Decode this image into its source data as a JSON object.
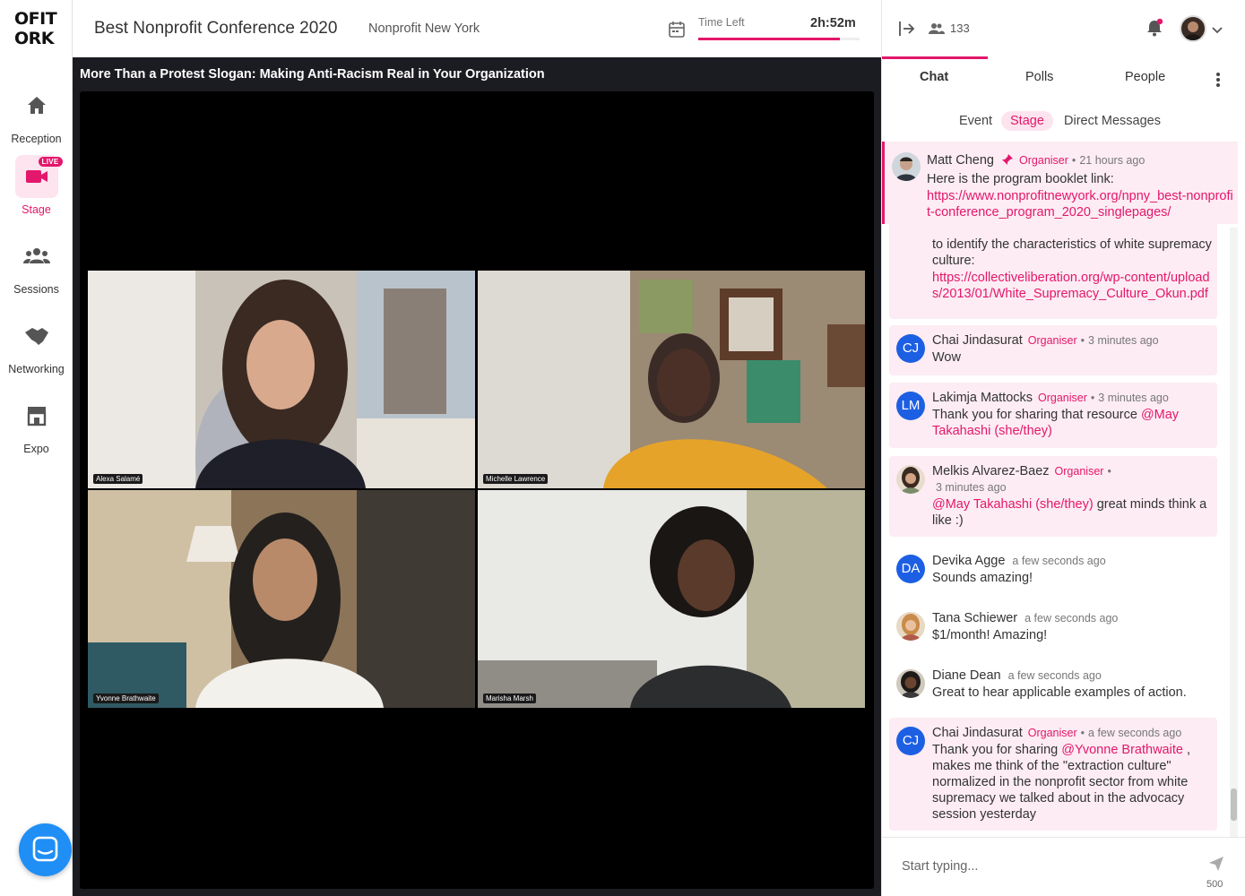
{
  "logo": {
    "line1": "OFIT",
    "line2": "ORK"
  },
  "nav": {
    "items": [
      {
        "label": "Reception",
        "icon": "home-icon"
      },
      {
        "label": "Stage",
        "icon": "video-camera-icon",
        "badge": "LIVE",
        "active": true
      },
      {
        "label": "Sessions",
        "icon": "group-icon"
      },
      {
        "label": "Networking",
        "icon": "handshake-icon"
      },
      {
        "label": "Expo",
        "icon": "store-icon"
      }
    ]
  },
  "header": {
    "event_title": "Best Nonprofit Conference 2020",
    "organizer": "Nonprofit New York",
    "time_left_label": "Time Left",
    "time_left_value": "2h:52m",
    "time_left_fraction": 0.88
  },
  "stage": {
    "session_title": "More Than a Protest Slogan: Making Anti-Racism Real in Your Organization",
    "participants": [
      {
        "name": "Alexa Salamé"
      },
      {
        "name": "Michelle Lawrence"
      },
      {
        "name": "Yvonne Brathwaite"
      },
      {
        "name": "Marisha Marsh"
      }
    ]
  },
  "panel": {
    "attendee_count": "133",
    "tabs": [
      "Chat",
      "Polls",
      "People"
    ],
    "active_tab": "Chat",
    "subtabs": [
      "Event",
      "Stage",
      "Direct Messages"
    ],
    "active_subtab": "Stage",
    "pinned": {
      "author": "Matt Cheng",
      "role": "Organiser",
      "time": "21 hours ago",
      "text": "Here is the program booklet link:",
      "link": "https://www.nonprofitnewyork.org/npny_best-nonprofit-conference_program_2020_singlepages/"
    },
    "messages": [
      {
        "text": "to identify the characteristics of white supremacy culture:",
        "link": "https://collectiveliberation.org/wp-content/uploads/2013/01/White_Supremacy_Culture_Okun.pdf"
      },
      {
        "initials": "CJ",
        "author": "Chai Jindasurat",
        "role": "Organiser",
        "time": "3 minutes ago",
        "text": "Wow"
      },
      {
        "initials": "LM",
        "author": "Lakimja Mattocks",
        "role": "Organiser",
        "time": "3 minutes ago",
        "text": "Thank you for sharing that resource",
        "mention": "@May Takahashi (she/they)"
      },
      {
        "author": "Melkis Alvarez-Baez",
        "role": "Organiser",
        "time": "3 minutes ago",
        "mention": "@May Takahashi (she/they)",
        "text": "great minds think a like :)"
      },
      {
        "initials": "DA",
        "author": "Devika Agge",
        "time": "a few seconds ago",
        "text": "Sounds amazing!"
      },
      {
        "author": "Tana Schiewer",
        "time": "a few seconds ago",
        "text": "$1/month! Amazing!"
      },
      {
        "author": "Diane Dean",
        "time": "a few seconds ago",
        "text": "Great to hear applicable examples of action."
      },
      {
        "initials": "CJ",
        "author": "Chai Jindasurat",
        "role": "Organiser",
        "time": "a few seconds ago",
        "text_before": "Thank you for sharing",
        "mention": "@Yvonne Brathwaite",
        "text_after": ", makes me think of the \"extraction culture\" normalized in the nonprofit sector from white supremacy we talked about in the advocacy session yesterday"
      }
    ],
    "composer": {
      "placeholder": "Start typing...",
      "char_limit": "500"
    }
  },
  "colors": {
    "accent": "#e3176b",
    "accent_light": "#fdecf3",
    "avatar_blue": "#1d5fe3",
    "stage_bg": "#1b1b22"
  }
}
